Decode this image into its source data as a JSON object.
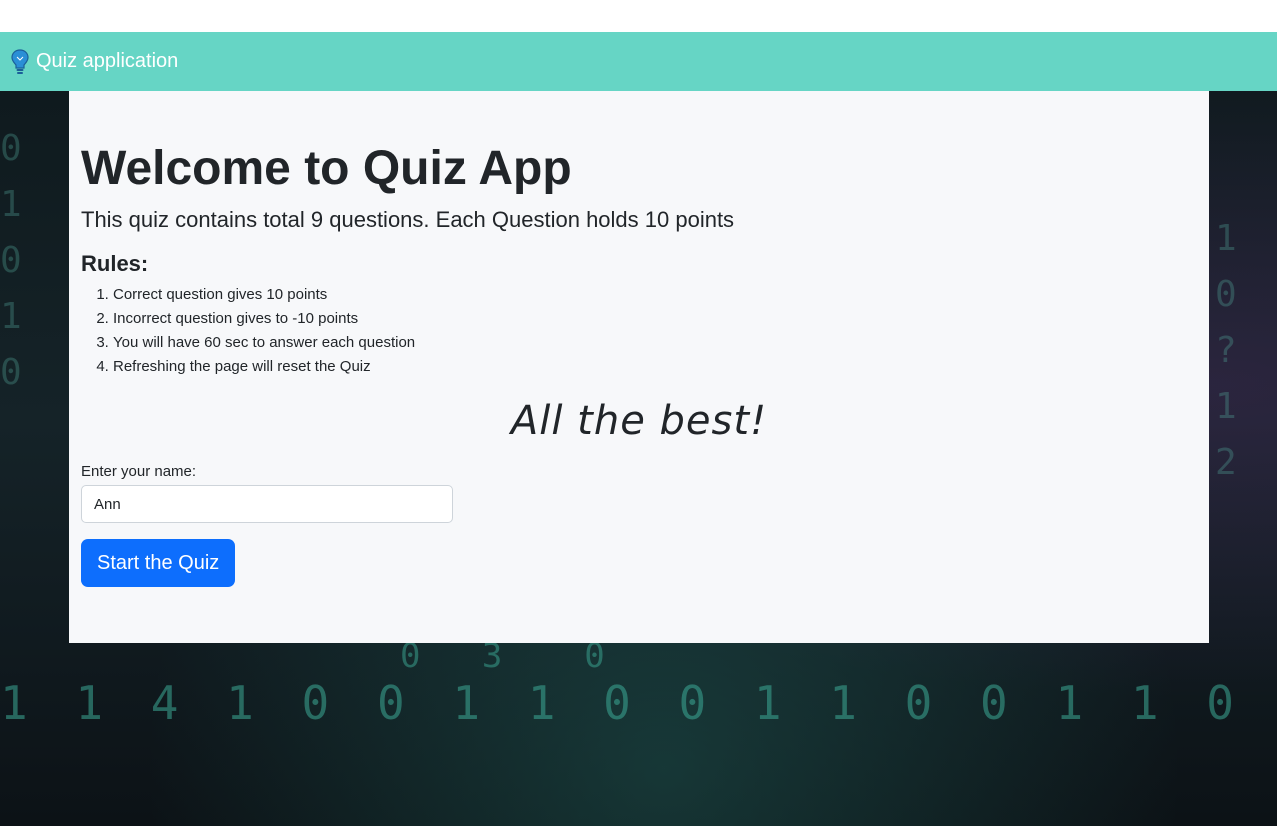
{
  "navbar": {
    "brand_label": "Quiz application",
    "brand_icon": "lightbulb-icon",
    "background_color": "#66d5c5"
  },
  "main": {
    "title": "Welcome to Quiz App",
    "subtitle": "This quiz contains total 9 questions. Each Question holds 10 points",
    "rules_heading": "Rules:",
    "rules": [
      "Correct question gives 10 points",
      "Incorrect question gives to -10 points",
      "You will have 60 sec to answer each question",
      "Refreshing the page will reset the Quiz"
    ],
    "encouragement": "All the best!",
    "name_label": "Enter your name:",
    "name_value": "Ann",
    "start_button_label": "Start the Quiz",
    "button_color": "#0d6efd"
  }
}
